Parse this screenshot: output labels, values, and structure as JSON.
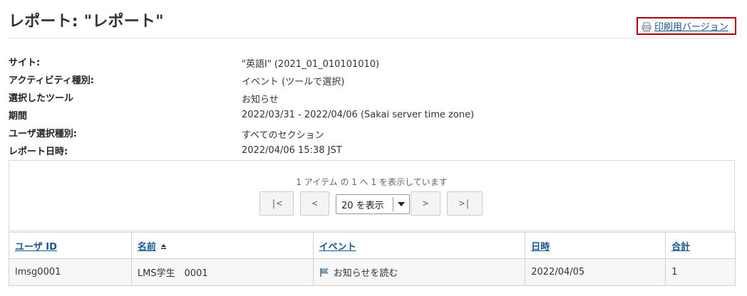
{
  "page": {
    "title": "レポート: \"レポート\""
  },
  "toolbar": {
    "print_label": "印刷用バージョン",
    "print_icon": "printer-icon"
  },
  "info": [
    {
      "key": "サイト:",
      "value": "\"英語Ⅰ\" (2021_01_010101010)"
    },
    {
      "key": "アクティビティ種別:",
      "value": "イベント (ツールで選択)"
    },
    {
      "key": "選択したツール",
      "value": "お知らせ"
    },
    {
      "key": "期間",
      "value": "2022/03/31 - 2022/04/06 (Sakai server time zone)"
    },
    {
      "key": "ユーザ選択種別:",
      "value": "すべてのセクション"
    },
    {
      "key": "レポート日時:",
      "value": "2022/04/06 15:38 JST"
    }
  ],
  "pager": {
    "status": "1 アイテム の 1 へ 1 を表示しています",
    "first": "|<",
    "prev": "<",
    "page_size": "20 を表示",
    "next": ">",
    "last": ">|"
  },
  "table": {
    "headers": [
      "ユーザ ID",
      "名前",
      "イベント",
      "日時",
      "合計"
    ],
    "sorted_column": "名前",
    "rows": [
      {
        "user_id": "lmsg0001",
        "name": "LMS学生　0001",
        "event": "お知らせを読む",
        "event_icon": "flag-icon",
        "date": "2022/04/05",
        "total": "1"
      }
    ]
  },
  "colors": {
    "link": "#15558d",
    "highlight_border": "#b40000",
    "row_bg": "#f7f7f7"
  }
}
